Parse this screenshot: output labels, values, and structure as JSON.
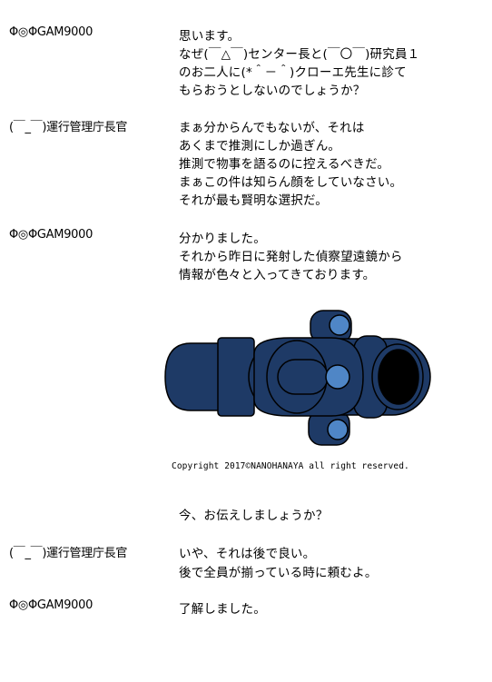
{
  "dialogue": [
    {
      "speaker": "Φ◎ΦGAM9000",
      "lines": [
        "思います。",
        "なぜ(￣△￣)センター長と(￣〇￣)研究員１",
        "のお二人に(*＾－＾)クローエ先生に診て",
        "もらおうとしないのでしょうか？"
      ]
    },
    {
      "speaker": "(￣_￣)運行管理庁長官",
      "lines": [
        "まぁ分からんでもないが、それは",
        "あくまで推測にしか過ぎん。",
        "推測で物事を語るのに控えるべきだ。",
        "まぁこの件は知らん顔をしていなさい。",
        "それが最も賢明な選択だ。"
      ]
    },
    {
      "speaker": "Φ◎ΦGAM9000",
      "lines": [
        "分かりました。",
        "それから昨日に発射した偵察望遠鏡から",
        "情報が色々と入ってきております。"
      ]
    },
    {
      "speaker": "",
      "lines": [
        "今、お伝えしましょうか？"
      ]
    },
    {
      "speaker": "(￣_￣)運行管理庁長官",
      "lines": [
        "いや、それは後で良い。",
        "後で全員が揃っている時に頼むよ。"
      ]
    },
    {
      "speaker": "Φ◎ΦGAM9000",
      "lines": [
        "了解しました。"
      ]
    }
  ],
  "illustration": {
    "copyright": "Copyright 2017©NANOHANAYA all right reserved.",
    "colors": {
      "body": "#1e3a66",
      "lens": "#000000",
      "knob": "#4f86c6"
    }
  }
}
